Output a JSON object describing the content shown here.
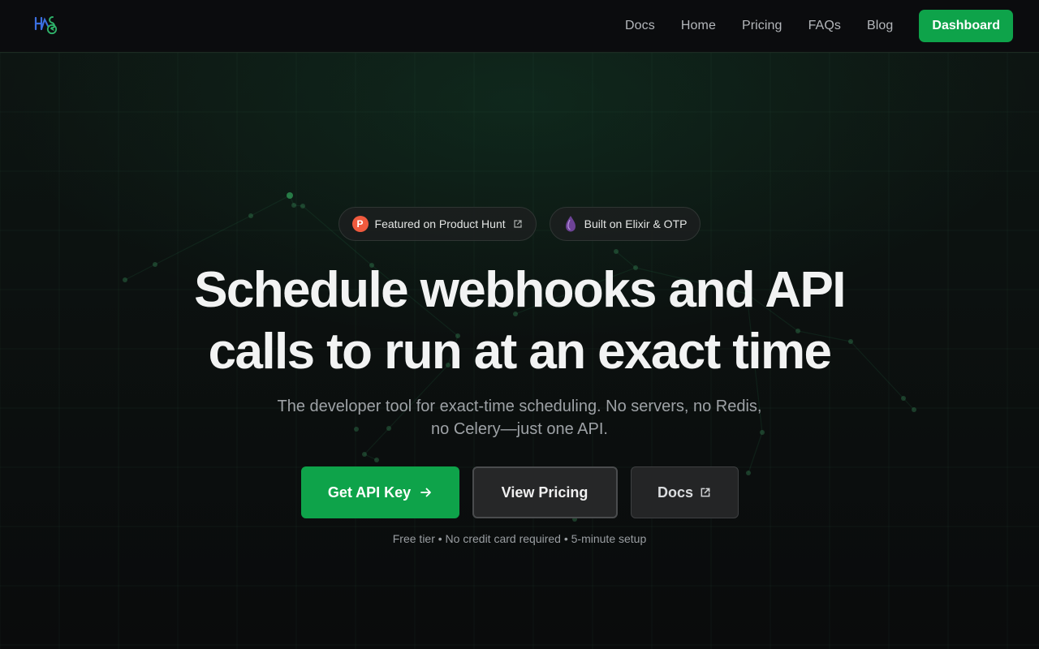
{
  "nav": {
    "logo_icon": "hms-logo-icon",
    "links": [
      "Docs",
      "Home",
      "Pricing",
      "FAQs",
      "Blog"
    ],
    "dashboard_label": "Dashboard"
  },
  "badges": {
    "product_hunt": {
      "label": "Featured on Product Hunt",
      "icon": "product-hunt-icon",
      "letter": "P"
    },
    "elixir": {
      "label": "Built on Elixir & OTP",
      "icon": "elixir-drop-icon"
    }
  },
  "hero": {
    "headline_line1": "Schedule webhooks and API",
    "headline_line2": "calls to run at an exact time",
    "subline_line1": "The developer tool for exact-time scheduling. No servers, no Redis,",
    "subline_line2": "no Celery—just one API."
  },
  "cta": {
    "primary_label": "Get API Key",
    "secondary_label": "View Pricing",
    "tertiary_label": "Docs"
  },
  "fineprint": "Free tier • No credit card required • 5-minute setup",
  "colors": {
    "accent": "#0ea34a",
    "background": "#0a0b0c",
    "product_hunt": "#f05a3e",
    "elixir": "#7b4fa8"
  }
}
